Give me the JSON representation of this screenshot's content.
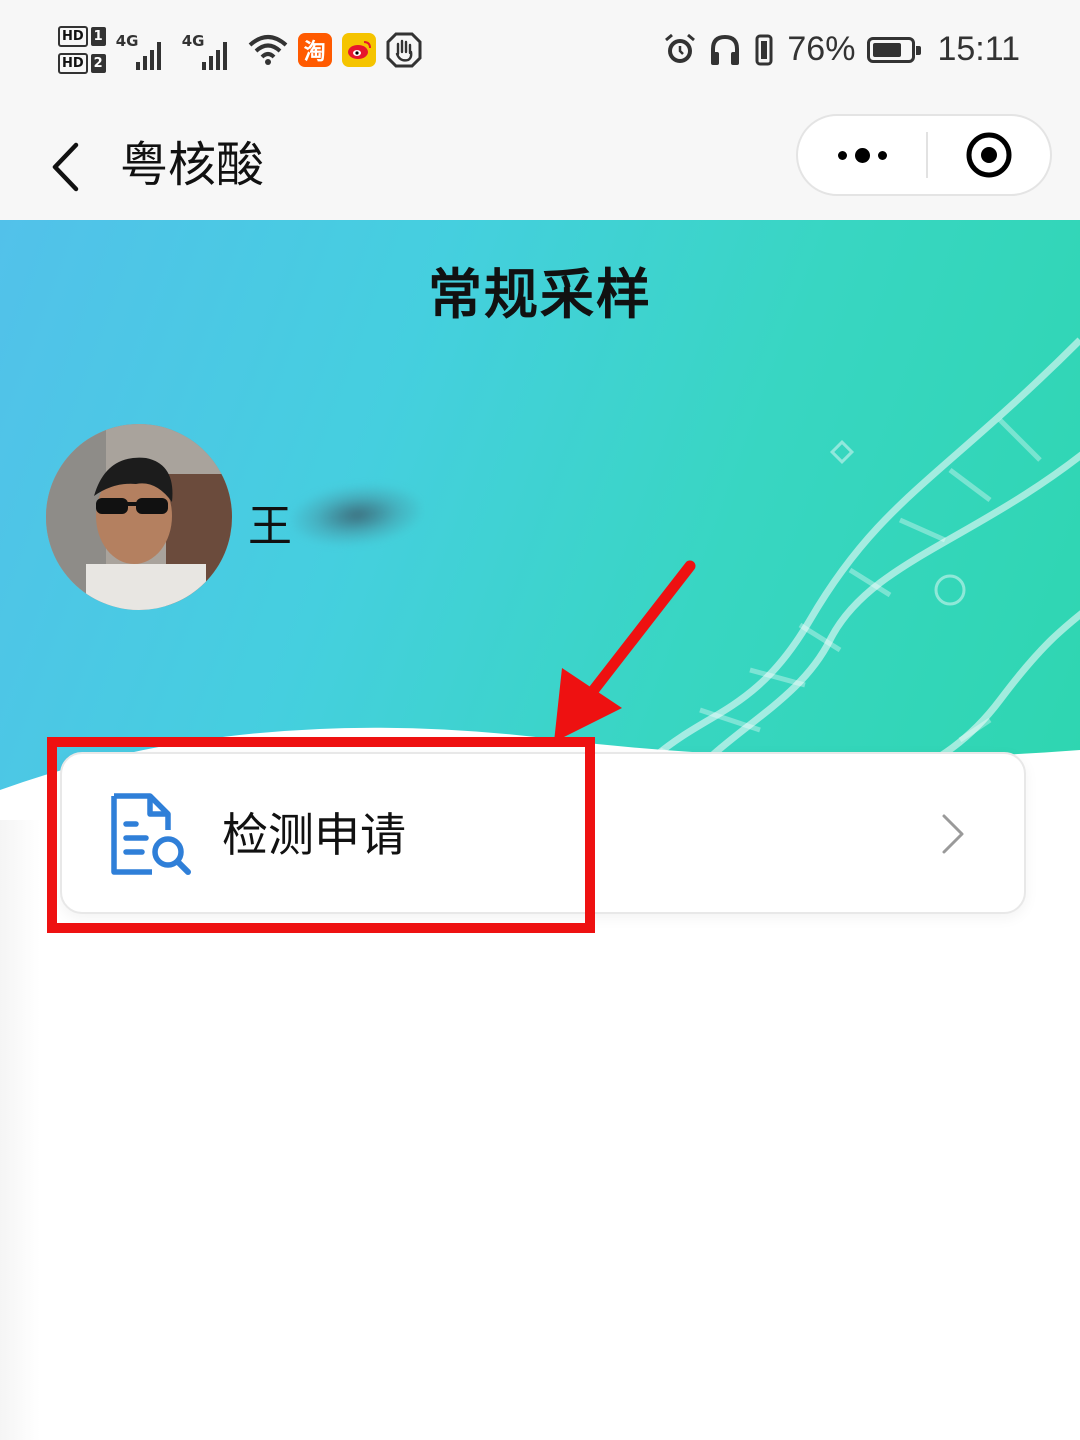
{
  "status_bar": {
    "sim1_label": "HD",
    "sim1_num": "1",
    "sim2_label": "HD",
    "sim2_num": "2",
    "net1": "4G",
    "net2": "4G",
    "taobao_icon_text": "淘",
    "battery_text": "76%",
    "battery_level": 0.76,
    "time": "15:11",
    "icons": [
      "wifi-icon",
      "taobao-icon",
      "weibo-icon",
      "hand-icon",
      "alarm-icon",
      "headphones-icon",
      "vibrate-icon",
      "battery-icon"
    ]
  },
  "nav": {
    "title": "粤核酸",
    "back_icon": "chevron-left-icon",
    "more_icon": "more-dots-icon",
    "close_icon": "target-close-icon"
  },
  "banner": {
    "title": "常规采样",
    "user_name": "王"
  },
  "menu": {
    "items": [
      {
        "label": "检测申请",
        "icon": "document-search-icon",
        "chevron": "chevron-right-icon"
      }
    ]
  },
  "colors": {
    "banner_start": "#52c1ea",
    "banner_end": "#2ed6b0",
    "icon_blue": "#2f7fd8",
    "highlight_red": "#ee1111"
  }
}
